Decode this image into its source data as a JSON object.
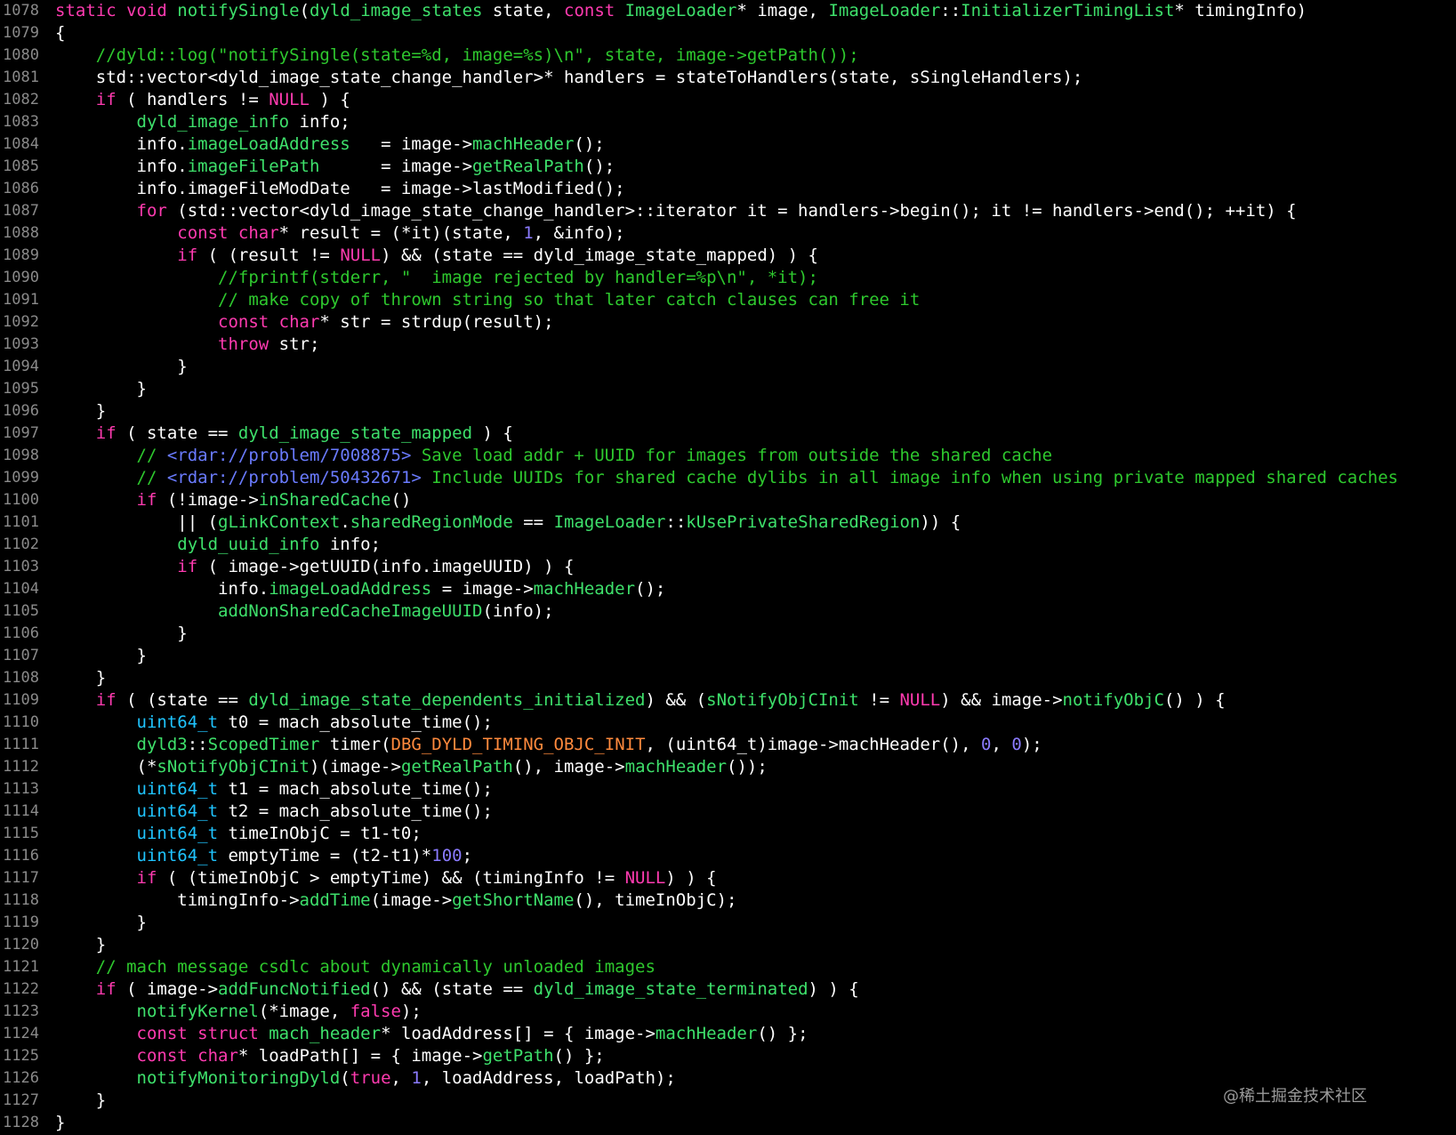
{
  "colors": {
    "background": "#000000",
    "line_number": "#8a8a8a",
    "keyword": "#ff3bb0",
    "function": "#3ee06b",
    "type": "#1fc4ff",
    "comment": "#2ec82e",
    "link": "#6a7bff",
    "number": "#8b7bff",
    "macro": "#ff8a3d",
    "plain": "#ffffff"
  },
  "watermark": "@稀土掘金技术社区",
  "lines": [
    {
      "n": "1078",
      "t": [
        [
          "kw",
          "static void "
        ],
        [
          "fn",
          "notifySingle"
        ],
        [
          "pl",
          "("
        ],
        [
          "fn",
          "dyld_image_states"
        ],
        [
          "pl",
          " state, "
        ],
        [
          "kw",
          "const "
        ],
        [
          "fn",
          "ImageLoader"
        ],
        [
          "pl",
          "* image, "
        ],
        [
          "fn",
          "ImageLoader"
        ],
        [
          "pl",
          "::"
        ],
        [
          "fn",
          "InitializerTimingList"
        ],
        [
          "pl",
          "* timingInfo)"
        ]
      ]
    },
    {
      "n": "1079",
      "t": [
        [
          "pl",
          "{"
        ]
      ]
    },
    {
      "n": "1080",
      "t": [
        [
          "cm",
          "    //dyld::log(\"notifySingle(state=%d, image=%s)\\n\", state, image->getPath());"
        ]
      ]
    },
    {
      "n": "1081",
      "t": [
        [
          "pl",
          "    std::vector<dyld_image_state_change_handler>* handlers = stateToHandlers(state, sSingleHandlers);"
        ]
      ]
    },
    {
      "n": "1082",
      "t": [
        [
          "kw",
          "    if"
        ],
        [
          "pl",
          " ( handlers != "
        ],
        [
          "kw",
          "NULL"
        ],
        [
          "pl",
          " ) {"
        ]
      ]
    },
    {
      "n": "1083",
      "t": [
        [
          "fn",
          "        dyld_image_info"
        ],
        [
          "pl",
          " info;"
        ]
      ]
    },
    {
      "n": "1084",
      "t": [
        [
          "pl",
          "        info."
        ],
        [
          "fn",
          "imageLoadAddress"
        ],
        [
          "pl",
          "   = image->"
        ],
        [
          "fn",
          "machHeader"
        ],
        [
          "pl",
          "();"
        ]
      ]
    },
    {
      "n": "1085",
      "t": [
        [
          "pl",
          "        info."
        ],
        [
          "fn",
          "imageFilePath"
        ],
        [
          "pl",
          "      = image->"
        ],
        [
          "fn",
          "getRealPath"
        ],
        [
          "pl",
          "();"
        ]
      ]
    },
    {
      "n": "1086",
      "t": [
        [
          "pl",
          "        info.imageFileModDate   = image->lastModified();"
        ]
      ]
    },
    {
      "n": "1087",
      "t": [
        [
          "kw",
          "        for"
        ],
        [
          "pl",
          " (std::vector<dyld_image_state_change_handler>::iterator it = handlers->begin(); it != handlers->end(); ++it) {"
        ]
      ]
    },
    {
      "n": "1088",
      "t": [
        [
          "kw",
          "            const char"
        ],
        [
          "pl",
          "* result = (*it)(state, "
        ],
        [
          "nm",
          "1"
        ],
        [
          "pl",
          ", &info);"
        ]
      ]
    },
    {
      "n": "1089",
      "t": [
        [
          "kw",
          "            if"
        ],
        [
          "pl",
          " ( (result != "
        ],
        [
          "kw",
          "NULL"
        ],
        [
          "pl",
          ") && (state == dyld_image_state_mapped) ) {"
        ]
      ]
    },
    {
      "n": "1090",
      "t": [
        [
          "cm",
          "                //fprintf(stderr, \"  image rejected by handler=%p\\n\", *it);"
        ]
      ]
    },
    {
      "n": "1091",
      "t": [
        [
          "cm",
          "                // make copy of thrown string so that later catch clauses can free it"
        ]
      ]
    },
    {
      "n": "1092",
      "t": [
        [
          "kw",
          "                const char"
        ],
        [
          "pl",
          "* str = strdup(result);"
        ]
      ]
    },
    {
      "n": "1093",
      "t": [
        [
          "kw",
          "                throw"
        ],
        [
          "pl",
          " str;"
        ]
      ]
    },
    {
      "n": "1094",
      "t": [
        [
          "pl",
          "            }"
        ]
      ]
    },
    {
      "n": "1095",
      "t": [
        [
          "pl",
          "        }"
        ]
      ]
    },
    {
      "n": "1096",
      "t": [
        [
          "pl",
          "    }"
        ]
      ]
    },
    {
      "n": "1097",
      "t": [
        [
          "kw",
          "    if"
        ],
        [
          "pl",
          " ( state == "
        ],
        [
          "fn",
          "dyld_image_state_mapped"
        ],
        [
          "pl",
          " ) {"
        ]
      ]
    },
    {
      "n": "1098",
      "t": [
        [
          "cm",
          "        // "
        ],
        [
          "lk",
          "<rdar://problem/7008875>"
        ],
        [
          "cm",
          " Save load addr + UUID for images from outside the shared cache"
        ]
      ]
    },
    {
      "n": "1099",
      "t": [
        [
          "cm",
          "        // "
        ],
        [
          "lk",
          "<rdar://problem/50432671>"
        ],
        [
          "cm",
          " Include UUIDs for shared cache dylibs in all image info when using private mapped shared caches"
        ]
      ]
    },
    {
      "n": "1100",
      "t": [
        [
          "kw",
          "        if"
        ],
        [
          "pl",
          " (!image->"
        ],
        [
          "fn",
          "inSharedCache"
        ],
        [
          "pl",
          "()"
        ]
      ]
    },
    {
      "n": "1101",
      "t": [
        [
          "pl",
          "            || ("
        ],
        [
          "fn",
          "gLinkContext"
        ],
        [
          "pl",
          "."
        ],
        [
          "fn",
          "sharedRegionMode"
        ],
        [
          "pl",
          " == "
        ],
        [
          "fn",
          "ImageLoader"
        ],
        [
          "pl",
          "::"
        ],
        [
          "fn",
          "kUsePrivateSharedRegion"
        ],
        [
          "pl",
          ")) {"
        ]
      ]
    },
    {
      "n": "1102",
      "t": [
        [
          "fn",
          "            dyld_uuid_info"
        ],
        [
          "pl",
          " info;"
        ]
      ]
    },
    {
      "n": "1103",
      "t": [
        [
          "kw",
          "            if"
        ],
        [
          "pl",
          " ( image->getUUID(info.imageUUID) ) {"
        ]
      ]
    },
    {
      "n": "1104",
      "t": [
        [
          "pl",
          "                info."
        ],
        [
          "fn",
          "imageLoadAddress"
        ],
        [
          "pl",
          " = image->"
        ],
        [
          "fn",
          "machHeader"
        ],
        [
          "pl",
          "();"
        ]
      ]
    },
    {
      "n": "1105",
      "t": [
        [
          "fn",
          "                addNonSharedCacheImageUUID"
        ],
        [
          "pl",
          "(info);"
        ]
      ]
    },
    {
      "n": "1106",
      "t": [
        [
          "pl",
          "            }"
        ]
      ]
    },
    {
      "n": "1107",
      "t": [
        [
          "pl",
          "        }"
        ]
      ]
    },
    {
      "n": "1108",
      "t": [
        [
          "pl",
          "    }"
        ]
      ]
    },
    {
      "n": "1109",
      "t": [
        [
          "kw",
          "    if"
        ],
        [
          "pl",
          " ( (state == "
        ],
        [
          "fn",
          "dyld_image_state_dependents_initialized"
        ],
        [
          "pl",
          ") && ("
        ],
        [
          "fn",
          "sNotifyObjCInit"
        ],
        [
          "pl",
          " != "
        ],
        [
          "kw",
          "NULL"
        ],
        [
          "pl",
          ") && image->"
        ],
        [
          "fn",
          "notifyObjC"
        ],
        [
          "pl",
          "() ) {"
        ]
      ]
    },
    {
      "n": "1110",
      "t": [
        [
          "ty",
          "        uint64_t"
        ],
        [
          "pl",
          " t0 = mach_absolute_time();"
        ]
      ]
    },
    {
      "n": "1111",
      "t": [
        [
          "fn",
          "        dyld3"
        ],
        [
          "pl",
          "::"
        ],
        [
          "fn",
          "ScopedTimer"
        ],
        [
          "pl",
          " timer("
        ],
        [
          "mc",
          "DBG_DYLD_TIMING_OBJC_INIT"
        ],
        [
          "pl",
          ", (uint64_t)image->machHeader(), "
        ],
        [
          "nm",
          "0"
        ],
        [
          "pl",
          ", "
        ],
        [
          "nm",
          "0"
        ],
        [
          "pl",
          ");"
        ]
      ]
    },
    {
      "n": "1112",
      "t": [
        [
          "pl",
          "        (*"
        ],
        [
          "fn",
          "sNotifyObjCInit"
        ],
        [
          "pl",
          ")(image->"
        ],
        [
          "fn",
          "getRealPath"
        ],
        [
          "pl",
          "(), image->"
        ],
        [
          "fn",
          "machHeader"
        ],
        [
          "pl",
          "());"
        ]
      ]
    },
    {
      "n": "1113",
      "t": [
        [
          "ty",
          "        uint64_t"
        ],
        [
          "pl",
          " t1 = mach_absolute_time();"
        ]
      ]
    },
    {
      "n": "1114",
      "t": [
        [
          "ty",
          "        uint64_t"
        ],
        [
          "pl",
          " t2 = mach_absolute_time();"
        ]
      ]
    },
    {
      "n": "1115",
      "t": [
        [
          "ty",
          "        uint64_t"
        ],
        [
          "pl",
          " timeInObjC = t1-t0;"
        ]
      ]
    },
    {
      "n": "1116",
      "t": [
        [
          "ty",
          "        uint64_t"
        ],
        [
          "pl",
          " emptyTime = (t2-t1)*"
        ],
        [
          "nm",
          "100"
        ],
        [
          "pl",
          ";"
        ]
      ]
    },
    {
      "n": "1117",
      "t": [
        [
          "kw",
          "        if"
        ],
        [
          "pl",
          " ( (timeInObjC > emptyTime) && (timingInfo != "
        ],
        [
          "kw",
          "NULL"
        ],
        [
          "pl",
          ") ) {"
        ]
      ]
    },
    {
      "n": "1118",
      "t": [
        [
          "pl",
          "            timingInfo->"
        ],
        [
          "fn",
          "addTime"
        ],
        [
          "pl",
          "(image->"
        ],
        [
          "fn",
          "getShortName"
        ],
        [
          "pl",
          "(), timeInObjC);"
        ]
      ]
    },
    {
      "n": "1119",
      "t": [
        [
          "pl",
          "        }"
        ]
      ]
    },
    {
      "n": "1120",
      "t": [
        [
          "pl",
          "    }"
        ]
      ]
    },
    {
      "n": "1121",
      "t": [
        [
          "cm",
          "    // mach message csdlc about dynamically unloaded images"
        ]
      ]
    },
    {
      "n": "1122",
      "t": [
        [
          "kw",
          "    if"
        ],
        [
          "pl",
          " ( image->"
        ],
        [
          "fn",
          "addFuncNotified"
        ],
        [
          "pl",
          "() && (state == "
        ],
        [
          "fn",
          "dyld_image_state_terminated"
        ],
        [
          "pl",
          ") ) {"
        ]
      ]
    },
    {
      "n": "1123",
      "t": [
        [
          "fn",
          "        notifyKernel"
        ],
        [
          "pl",
          "(*image, "
        ],
        [
          "kw",
          "false"
        ],
        [
          "pl",
          ");"
        ]
      ]
    },
    {
      "n": "1124",
      "t": [
        [
          "kw",
          "        const struct "
        ],
        [
          "fn",
          "mach_header"
        ],
        [
          "pl",
          "* loadAddress[] = { image->"
        ],
        [
          "fn",
          "machHeader"
        ],
        [
          "pl",
          "() };"
        ]
      ]
    },
    {
      "n": "1125",
      "t": [
        [
          "kw",
          "        const char"
        ],
        [
          "pl",
          "* loadPath[] = { image->"
        ],
        [
          "fn",
          "getPath"
        ],
        [
          "pl",
          "() };"
        ]
      ]
    },
    {
      "n": "1126",
      "t": [
        [
          "fn",
          "        notifyMonitoringDyld"
        ],
        [
          "pl",
          "("
        ],
        [
          "kw",
          "true"
        ],
        [
          "pl",
          ", "
        ],
        [
          "nm",
          "1"
        ],
        [
          "pl",
          ", loadAddress, loadPath);"
        ]
      ]
    },
    {
      "n": "1127",
      "t": [
        [
          "pl",
          "    }"
        ]
      ]
    },
    {
      "n": "1128",
      "t": [
        [
          "pl",
          "}"
        ]
      ]
    }
  ]
}
